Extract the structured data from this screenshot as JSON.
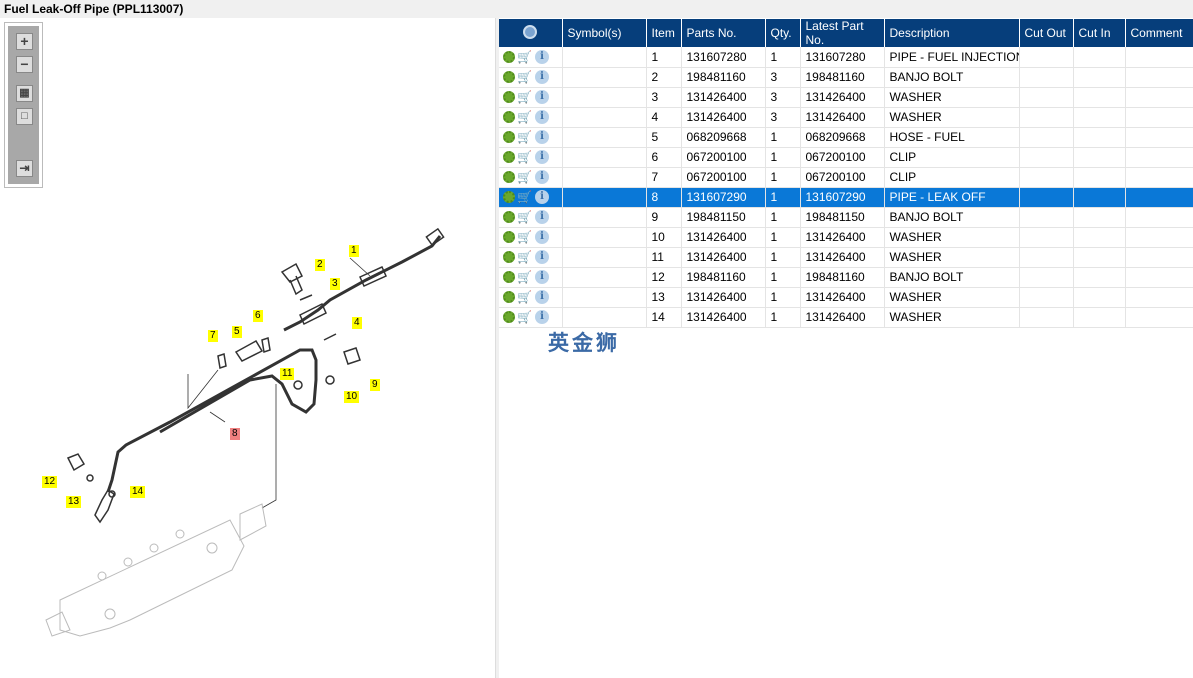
{
  "title": "Fuel Leak-Off Pipe (PPL113007)",
  "toolbar": {
    "zoom_in": "+",
    "zoom_out": "−",
    "fit": "▦",
    "actual": "□",
    "export": "⇥"
  },
  "columns": [
    "Symbol(s)",
    "Item",
    "Parts No.",
    "Qty.",
    "Latest Part No.",
    "Description",
    "Cut Out",
    "Cut In",
    "Comment"
  ],
  "selected_item": "8",
  "rows": [
    {
      "item": "1",
      "part": "131607280",
      "qty": "1",
      "latest": "131607280",
      "desc": "PIPE - FUEL INJECTION"
    },
    {
      "item": "2",
      "part": "198481160",
      "qty": "3",
      "latest": "198481160",
      "desc": "BANJO BOLT"
    },
    {
      "item": "3",
      "part": "131426400",
      "qty": "3",
      "latest": "131426400",
      "desc": "WASHER"
    },
    {
      "item": "4",
      "part": "131426400",
      "qty": "3",
      "latest": "131426400",
      "desc": "WASHER"
    },
    {
      "item": "5",
      "part": "068209668",
      "qty": "1",
      "latest": "068209668",
      "desc": "HOSE - FUEL"
    },
    {
      "item": "6",
      "part": "067200100",
      "qty": "1",
      "latest": "067200100",
      "desc": "CLIP"
    },
    {
      "item": "7",
      "part": "067200100",
      "qty": "1",
      "latest": "067200100",
      "desc": "CLIP"
    },
    {
      "item": "8",
      "part": "131607290",
      "qty": "1",
      "latest": "131607290",
      "desc": "PIPE - LEAK OFF"
    },
    {
      "item": "9",
      "part": "198481150",
      "qty": "1",
      "latest": "198481150",
      "desc": "BANJO BOLT"
    },
    {
      "item": "10",
      "part": "131426400",
      "qty": "1",
      "latest": "131426400",
      "desc": "WASHER"
    },
    {
      "item": "11",
      "part": "131426400",
      "qty": "1",
      "latest": "131426400",
      "desc": "WASHER"
    },
    {
      "item": "12",
      "part": "198481160",
      "qty": "1",
      "latest": "198481160",
      "desc": "BANJO BOLT"
    },
    {
      "item": "13",
      "part": "131426400",
      "qty": "1",
      "latest": "131426400",
      "desc": "WASHER"
    },
    {
      "item": "14",
      "part": "131426400",
      "qty": "1",
      "latest": "131426400",
      "desc": "WASHER"
    }
  ],
  "callouts": [
    "1",
    "2",
    "3",
    "4",
    "5",
    "6",
    "7",
    "8",
    "9",
    "10",
    "11",
    "12",
    "13",
    "14"
  ],
  "watermark": "英金狮",
  "colors": {
    "header": "#063e7b",
    "selected": "#0a78d7",
    "callout": "#ffff00",
    "callout_selected": "#f08080"
  }
}
